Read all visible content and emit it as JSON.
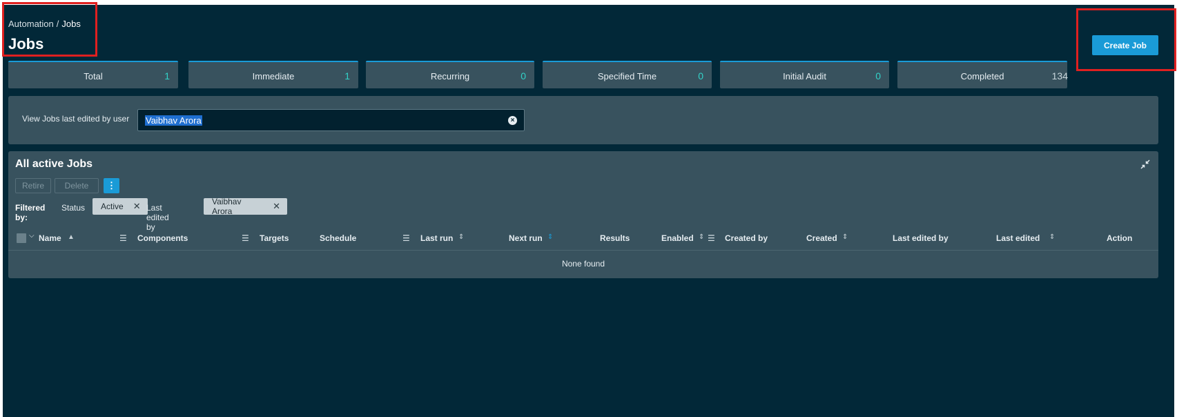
{
  "breadcrumb": {
    "parent": "Automation",
    "separator": "/",
    "current": "Jobs"
  },
  "page": {
    "title": "Jobs"
  },
  "header": {
    "create_label": "Create Job"
  },
  "stats": [
    {
      "label": "Total",
      "value": "1"
    },
    {
      "label": "Immediate",
      "value": "1"
    },
    {
      "label": "Recurring",
      "value": "0"
    },
    {
      "label": "Specified Time",
      "value": "0"
    },
    {
      "label": "Initial Audit",
      "value": "0"
    },
    {
      "label": "Completed",
      "value": "134"
    }
  ],
  "user_filter": {
    "label": "View Jobs last edited by user",
    "value": "Vaibhav Arora"
  },
  "jobs": {
    "title": "All active Jobs",
    "retire_label": "Retire",
    "delete_label": "Delete",
    "more_label": "⋮",
    "filtered_by": "Filtered by:",
    "filters": [
      {
        "key": "Status",
        "value": "Active"
      },
      {
        "key": "Last edited by",
        "value": "Vaibhav Arora"
      }
    ],
    "columns": {
      "name": "Name",
      "components": "Components",
      "targets": "Targets",
      "schedule": "Schedule",
      "last_run": "Last run",
      "next_run": "Next run",
      "results": "Results",
      "enabled": "Enabled",
      "created_by": "Created by",
      "created": "Created",
      "last_edited_by": "Last edited by",
      "last_edited": "Last edited",
      "action": "Action"
    },
    "empty_text": "None found"
  },
  "colors": {
    "background": "#022838",
    "panel": "#38525e",
    "accent": "#1a9bd7",
    "stat_value": "#32d2c8",
    "annotation": "#e02020"
  }
}
